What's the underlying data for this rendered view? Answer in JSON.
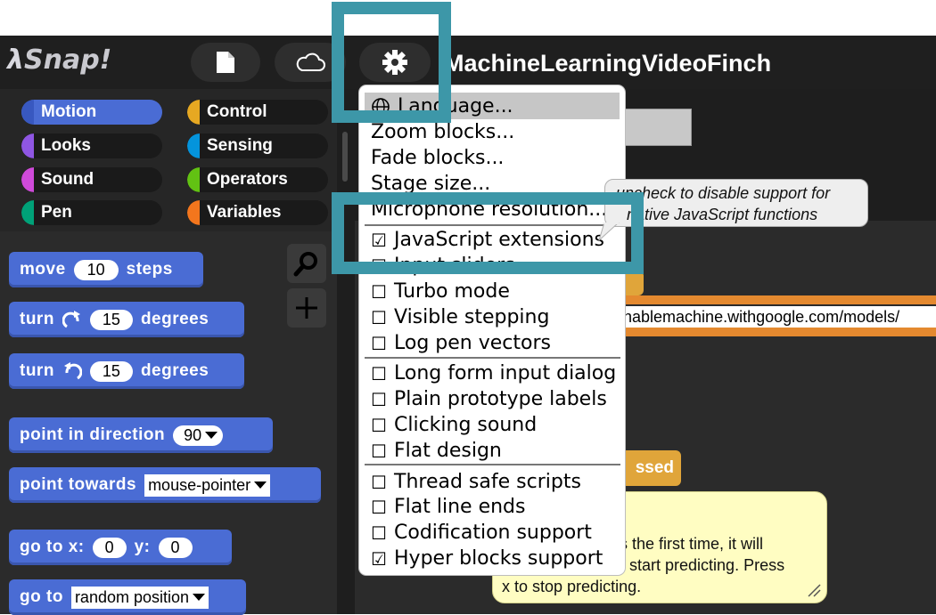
{
  "app": {
    "logo_text": "Snap!",
    "project_title": "MachineLearningVideoFinch"
  },
  "toolbar": {
    "buttons": [
      {
        "name": "file-button",
        "icon": "file-icon"
      },
      {
        "name": "cloud-button",
        "icon": "cloud-icon"
      },
      {
        "name": "settings-button",
        "icon": "gear-icon"
      }
    ]
  },
  "categories": [
    {
      "label": "Motion",
      "color": "#4a6cd4",
      "active": true
    },
    {
      "label": "Looks",
      "color": "#8f56e3"
    },
    {
      "label": "Sound",
      "color": "#cf4ad9"
    },
    {
      "label": "Pen",
      "color": "#00a178"
    },
    {
      "label": "Control",
      "color": "#e6a822"
    },
    {
      "label": "Sensing",
      "color": "#0494dc"
    },
    {
      "label": "Operators",
      "color": "#62c213"
    },
    {
      "label": "Variables",
      "color": "#f3761d"
    }
  ],
  "palette_tools": [
    {
      "name": "search-icon"
    },
    {
      "name": "plus-icon"
    }
  ],
  "blocks": {
    "move": {
      "pre": "move",
      "value": "10",
      "post": "steps"
    },
    "turn_cw": {
      "pre": "turn",
      "value": "15",
      "post": "degrees"
    },
    "turn_ccw": {
      "pre": "turn",
      "value": "15",
      "post": "degrees"
    },
    "point_dir": {
      "pre": "point in direction",
      "value": "90"
    },
    "point_towards": {
      "pre": "point towards",
      "value": "mouse-pointer"
    },
    "goto_xy": {
      "pre": "go to x:",
      "x": "0",
      "mid": "y:",
      "y": "0"
    },
    "goto": {
      "pre": "go to",
      "value": "random position"
    }
  },
  "settings_menu": {
    "items": [
      {
        "label": "Language...",
        "icon": "globe-icon",
        "highlighted": true
      },
      {
        "label": "Zoom blocks..."
      },
      {
        "label": "Fade blocks..."
      },
      {
        "label": "Stage size..."
      },
      {
        "label": "Microphone resolution..."
      },
      {
        "label": "JavaScript extensions",
        "checked": true
      },
      {
        "label": "Input sliders",
        "checked": true
      },
      {
        "label": "Turbo mode",
        "checked": false
      },
      {
        "label": "Visible stepping",
        "checked": false
      },
      {
        "label": "Log pen vectors",
        "checked": false
      },
      {
        "label": "Long form input dialog",
        "checked": false
      },
      {
        "label": "Plain prototype labels",
        "checked": false
      },
      {
        "label": "Clicking sound",
        "checked": false
      },
      {
        "label": "Flat design",
        "checked": false
      },
      {
        "label": "Thread safe scripts",
        "checked": false
      },
      {
        "label": "Flat line ends",
        "checked": false
      },
      {
        "label": "Codification support",
        "checked": false
      },
      {
        "label": "Hyper blocks support",
        "checked": true
      }
    ]
  },
  "tooltip": {
    "line1": "uncheck to disable support for",
    "line2": "native JavaScript functions"
  },
  "script_area": {
    "url_fragment": "chablemachine.withgoogle.com/models/",
    "event_block_fragment": "ssed",
    "note_line1": "his the first time, it will",
    "note_line2": "o start predicting. Press",
    "note_line3": "x to stop predicting."
  },
  "colors": {
    "accent_highlight": "#3d97a8",
    "motion": "#4a6cd4",
    "control": "#e0a53a",
    "variables": "#e4892f",
    "note_bg": "#fffdc2"
  }
}
